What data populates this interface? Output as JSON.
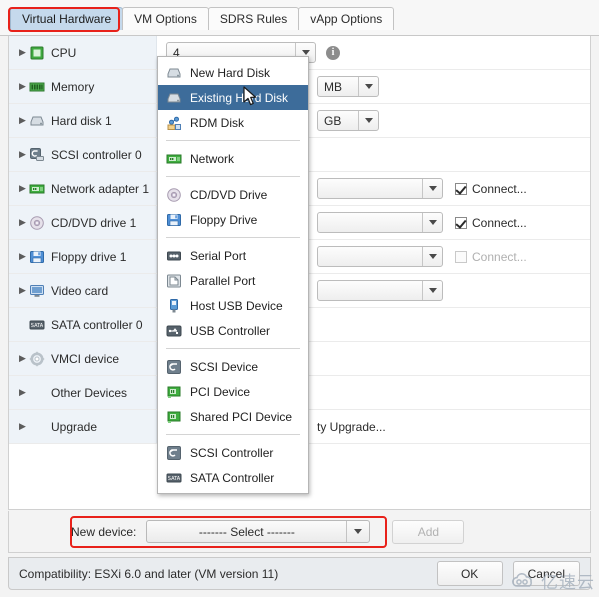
{
  "tabs": [
    {
      "label": "Virtual Hardware",
      "active": true
    },
    {
      "label": "VM Options",
      "active": false
    },
    {
      "label": "SDRS Rules",
      "active": false
    },
    {
      "label": "vApp Options",
      "active": false
    }
  ],
  "device_rows": [
    {
      "label": "CPU",
      "icon": "cpu-icon",
      "expandable": true,
      "field": "combo",
      "value": "4",
      "info": true
    },
    {
      "label": "Memory",
      "icon": "memory-icon",
      "expandable": true,
      "field": "unit",
      "value": "MB"
    },
    {
      "label": "Hard disk 1",
      "icon": "hard-disk-icon",
      "expandable": true,
      "field": "unit",
      "value": "GB"
    },
    {
      "label": "SCSI controller 0",
      "icon": "scsi-controller-icon",
      "expandable": true,
      "field": "none",
      "value": ""
    },
    {
      "label": "Network adapter 1",
      "icon": "network-adapter-icon",
      "expandable": true,
      "field": "combo_check",
      "value": "",
      "checkbox": "Connect...",
      "checked": true
    },
    {
      "label": "CD/DVD drive 1",
      "icon": "cddvd-icon",
      "expandable": true,
      "field": "combo_check",
      "value": "",
      "checkbox": "Connect...",
      "checked": true
    },
    {
      "label": "Floppy drive 1",
      "icon": "floppy-icon",
      "expandable": true,
      "field": "combo_check",
      "value": "",
      "checkbox": "Connect...",
      "checked": false,
      "disabled": true
    },
    {
      "label": "Video card",
      "icon": "video-card-icon",
      "expandable": true,
      "field": "combo",
      "value": ""
    },
    {
      "label": "SATA controller 0",
      "icon": "sata-controller-icon",
      "expandable": false,
      "field": "none",
      "value": ""
    },
    {
      "label": "VMCI device",
      "icon": "vmci-icon",
      "expandable": true,
      "field": "none",
      "value": ""
    },
    {
      "label": "Other Devices",
      "icon": "none",
      "expandable": true,
      "field": "none",
      "value": ""
    },
    {
      "label": "Upgrade",
      "icon": "none",
      "expandable": true,
      "field": "text",
      "value": "ty Upgrade..."
    }
  ],
  "menu": {
    "groups": [
      [
        {
          "label": "New Hard Disk",
          "icon": "hard-disk-icon",
          "selected": false
        },
        {
          "label": "Existing Hard Disk",
          "icon": "hard-disk-icon",
          "selected": true
        },
        {
          "label": "RDM Disk",
          "icon": "rdm-disk-icon",
          "selected": false
        }
      ],
      [
        {
          "label": "Network",
          "icon": "network-adapter-icon",
          "selected": false
        }
      ],
      [
        {
          "label": "CD/DVD Drive",
          "icon": "cddvd-icon",
          "selected": false
        },
        {
          "label": "Floppy Drive",
          "icon": "floppy-icon",
          "selected": false
        }
      ],
      [
        {
          "label": "Serial Port",
          "icon": "serial-port-icon",
          "selected": false
        },
        {
          "label": "Parallel Port",
          "icon": "parallel-port-icon",
          "selected": false
        },
        {
          "label": "Host USB Device",
          "icon": "usb-device-icon",
          "selected": false
        },
        {
          "label": "USB Controller",
          "icon": "usb-controller-icon",
          "selected": false
        }
      ],
      [
        {
          "label": "SCSI Device",
          "icon": "scsi-device-icon",
          "selected": false
        },
        {
          "label": "PCI Device",
          "icon": "pci-device-icon",
          "selected": false
        },
        {
          "label": "Shared PCI Device",
          "icon": "pci-device-icon",
          "selected": false
        }
      ],
      [
        {
          "label": "SCSI Controller",
          "icon": "scsi-device-icon",
          "selected": false
        },
        {
          "label": "SATA Controller",
          "icon": "sata-controller-icon",
          "selected": false
        }
      ]
    ]
  },
  "new_device": {
    "label": "New device:",
    "selected": "------- Select -------",
    "add_label": "Add"
  },
  "footer": {
    "compatibility": "Compatibility: ESXi 6.0 and later (VM version 11)",
    "ok_label": "OK",
    "cancel_label": "Cancel"
  },
  "watermark": {
    "text": "亿速云"
  },
  "colors": {
    "accent_tab": "#c5d9ec",
    "menu_selected": "#3d6c9a",
    "annotation": "#e8211a",
    "sidebar": "#eef3f8"
  }
}
